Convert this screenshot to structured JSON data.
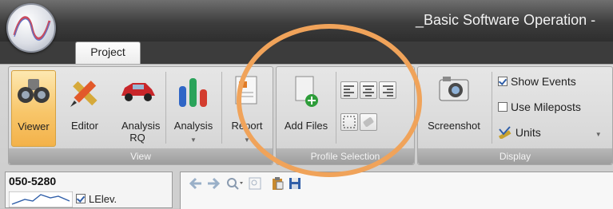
{
  "window": {
    "title": "_Basic Software Operation -"
  },
  "tabs": [
    {
      "label": "Project"
    }
  ],
  "groups": {
    "view": {
      "label": "View",
      "buttons": [
        {
          "label": "Viewer",
          "icon": "binoculars-icon"
        },
        {
          "label": "Editor",
          "icon": "pencil-ruler-icon"
        },
        {
          "label": "Analysis RQ",
          "icon": "car-icon"
        },
        {
          "label": "Analysis",
          "icon": "bar-chart-icon"
        },
        {
          "label": "Report",
          "icon": "report-icon"
        }
      ]
    },
    "profile_selection": {
      "label": "Profile Selection",
      "add_files": "Add Files"
    },
    "display": {
      "label": "Display",
      "screenshot": "Screenshot",
      "show_events": "Show Events",
      "use_mileposts": "Use Mileposts",
      "units": "Units"
    }
  },
  "checkboxes": {
    "show_events": true,
    "use_mileposts": false,
    "lelev": true
  },
  "left_panel": {
    "route": "050-5280",
    "legend_label": "LElev."
  },
  "colors": {
    "highlight_ring": "#f0a35a",
    "active_button": "#f8c66a",
    "accent_blue": "#2f5ea8"
  }
}
